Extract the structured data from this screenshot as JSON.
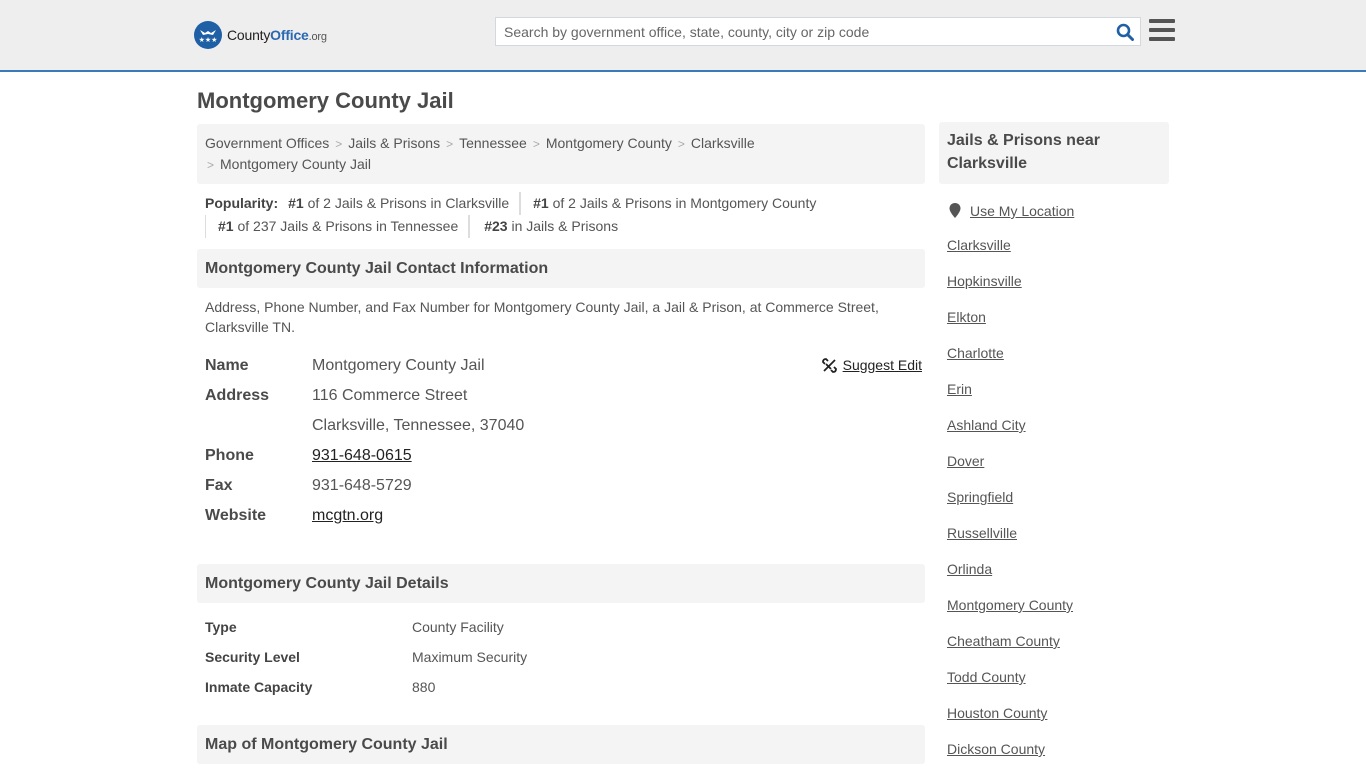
{
  "header": {
    "logo": {
      "county": "County",
      "office": "Office",
      "tld": ".org"
    },
    "search": {
      "placeholder": "Search by government office, state, county, city or zip code",
      "value": ""
    },
    "brand_color": "#2a68b1",
    "accent_border": "#3a7ab8"
  },
  "page": {
    "title": "Montgomery County Jail"
  },
  "breadcrumb": [
    {
      "label": "Government Offices"
    },
    {
      "label": "Jails & Prisons"
    },
    {
      "label": "Tennessee"
    },
    {
      "label": "Montgomery County"
    },
    {
      "label": "Clarksville"
    },
    {
      "label": "Montgomery County Jail"
    }
  ],
  "popularity": {
    "label": "Popularity:",
    "items": [
      {
        "rank": "#1",
        "text": " of 2 Jails & Prisons in Clarksville"
      },
      {
        "rank": "#1",
        "text": " of 2 Jails & Prisons in Montgomery County"
      },
      {
        "rank": "#1",
        "text": " of 237 Jails & Prisons in Tennessee"
      },
      {
        "rank": "#23",
        "text": " in Jails & Prisons"
      }
    ]
  },
  "contact": {
    "heading": "Montgomery County Jail Contact Information",
    "description": "Address, Phone Number, and Fax Number for Montgomery County Jail, a Jail & Prison, at Commerce Street, Clarksville TN.",
    "suggest_edit": "Suggest Edit",
    "name_label": "Name",
    "name": "Montgomery County Jail",
    "address_label": "Address",
    "address_line1": "116 Commerce Street",
    "address_line2": "Clarksville, Tennessee, 37040",
    "phone_label": "Phone",
    "phone": "931-648-0615",
    "fax_label": "Fax",
    "fax": "931-648-5729",
    "website_label": "Website",
    "website": "mcgtn.org"
  },
  "details": {
    "heading": "Montgomery County Jail Details",
    "rows": [
      {
        "label": "Type",
        "value": "County Facility"
      },
      {
        "label": "Security Level",
        "value": "Maximum Security"
      },
      {
        "label": "Inmate Capacity",
        "value": "880"
      }
    ]
  },
  "map": {
    "heading": "Map of Montgomery County Jail"
  },
  "sidebar": {
    "heading": "Jails & Prisons near Clarksville",
    "use_location": "Use My Location",
    "links": [
      "Clarksville",
      "Hopkinsville",
      "Elkton",
      "Charlotte",
      "Erin",
      "Ashland City",
      "Dover",
      "Springfield",
      "Russellville",
      "Orlinda",
      "Montgomery County",
      "Cheatham County",
      "Todd County",
      "Houston County",
      "Dickson County"
    ]
  }
}
